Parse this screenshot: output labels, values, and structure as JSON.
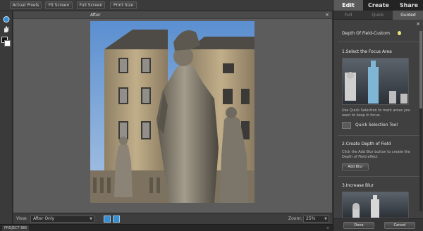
{
  "toolbar": {
    "actual_pixels": "Actual Pixels",
    "fit_screen": "Fit Screen",
    "full_screen": "Full Screen",
    "print_size": "Print Size"
  },
  "document": {
    "title": "After",
    "close_glyph": "×"
  },
  "viewbar": {
    "view_label": "View:",
    "view_value": "After Only",
    "zoom_label": "Zoom:",
    "zoom_value": "25%"
  },
  "project_bin": {
    "label": "PROJECT BIN",
    "menu_glyph": "≡"
  },
  "panel": {
    "mode_tabs": [
      "Edit",
      "Create",
      "Share"
    ],
    "sub_tabs": [
      "Full",
      "Quick",
      "Guided"
    ],
    "guide_title": "Depth Of Field-Custom",
    "close_glyph": "×",
    "step1": {
      "heading": "1.Select the Focus Area",
      "body": "Use Quick Selection to mark areas you want to keep in focus.",
      "tool_label": "Quick Selection Tool"
    },
    "step2": {
      "heading": "2.Create Depth of Field",
      "body": "Click the Add Blur button to create the Depth of Field effect",
      "button": "Add Blur"
    },
    "step3": {
      "heading": "3.Increase Blur"
    },
    "done": "Done",
    "cancel": "Cancel"
  },
  "colors": {
    "accent": "#3a8fd0",
    "sky": "#7ea6d3",
    "stone": "#b8a684"
  }
}
